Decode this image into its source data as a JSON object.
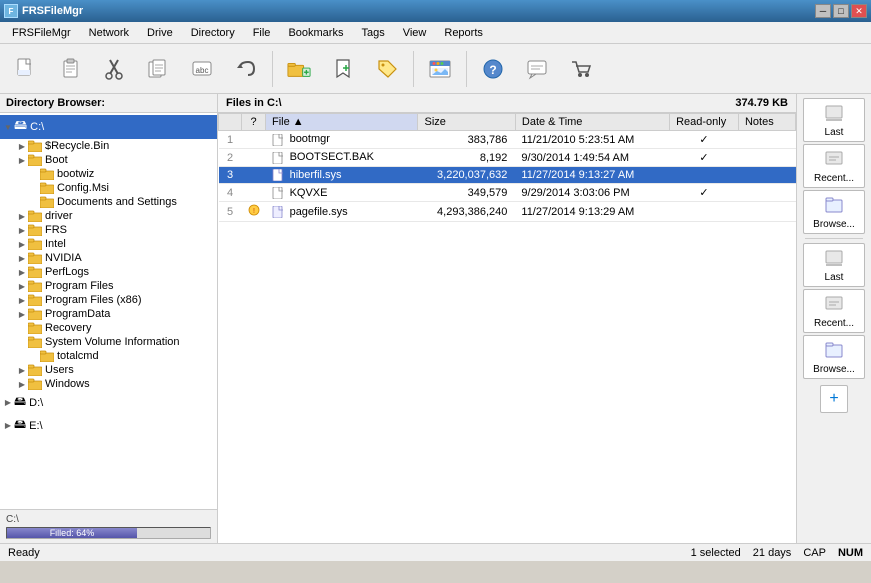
{
  "window": {
    "title": "FRSFileMgr",
    "icon": "F"
  },
  "title_controls": {
    "minimize": "─",
    "maximize": "□",
    "close": "✕"
  },
  "menu": {
    "items": [
      "FRSFileMgr",
      "Network",
      "Drive",
      "Directory",
      "File",
      "Bookmarks",
      "Tags",
      "View",
      "Reports"
    ]
  },
  "toolbar": {
    "buttons": [
      {
        "name": "new",
        "icon": "📄"
      },
      {
        "name": "open",
        "icon": "📋"
      },
      {
        "name": "cut",
        "icon": "✂"
      },
      {
        "name": "copy",
        "icon": "📄"
      },
      {
        "name": "rename",
        "icon": "abc"
      },
      {
        "name": "undo",
        "icon": "↩"
      },
      {
        "name": "browse",
        "icon": "📂"
      },
      {
        "name": "add-bookmark",
        "icon": "🔖"
      },
      {
        "name": "tag",
        "icon": "🏷"
      },
      {
        "name": "image",
        "icon": "🖼"
      },
      {
        "name": "help",
        "icon": "?"
      },
      {
        "name": "chat",
        "icon": "💬"
      },
      {
        "name": "cart",
        "icon": "🛒"
      }
    ]
  },
  "dir_panel": {
    "header": "Directory Browser:",
    "tree": [
      {
        "id": "c-drive",
        "label": "C:\\",
        "indent": 0,
        "expanded": true,
        "is_drive": true,
        "selected": true
      },
      {
        "id": "recycle",
        "label": "$Recycle.Bin",
        "indent": 1,
        "expanded": false
      },
      {
        "id": "boot",
        "label": "Boot",
        "indent": 1,
        "expanded": false
      },
      {
        "id": "bootwiz",
        "label": "bootwiz",
        "indent": 1,
        "expanded": false
      },
      {
        "id": "config",
        "label": "Config.Msi",
        "indent": 1,
        "expanded": false
      },
      {
        "id": "docs",
        "label": "Documents and Settings",
        "indent": 1,
        "expanded": false
      },
      {
        "id": "driver",
        "label": "driver",
        "indent": 1,
        "expanded": false
      },
      {
        "id": "frs",
        "label": "FRS",
        "indent": 1,
        "expanded": false
      },
      {
        "id": "intel",
        "label": "Intel",
        "indent": 1,
        "expanded": false
      },
      {
        "id": "nvidia",
        "label": "NVIDIA",
        "indent": 1,
        "expanded": false
      },
      {
        "id": "perflogs",
        "label": "PerfLogs",
        "indent": 1,
        "expanded": false
      },
      {
        "id": "programfiles",
        "label": "Program Files",
        "indent": 1,
        "expanded": false
      },
      {
        "id": "programfilesx86",
        "label": "Program Files (x86)",
        "indent": 1,
        "expanded": false
      },
      {
        "id": "programdata",
        "label": "ProgramData",
        "indent": 1,
        "expanded": false
      },
      {
        "id": "recovery",
        "label": "Recovery",
        "indent": 1,
        "expanded": false
      },
      {
        "id": "systemvolume",
        "label": "System Volume Information",
        "indent": 1,
        "expanded": false
      },
      {
        "id": "totalcmd",
        "label": "totalcmd",
        "indent": 1,
        "expanded": false
      },
      {
        "id": "users",
        "label": "Users",
        "indent": 1,
        "expanded": false
      },
      {
        "id": "windows",
        "label": "Windows",
        "indent": 1,
        "expanded": false
      },
      {
        "id": "d-drive",
        "label": "D:\\",
        "indent": 0,
        "expanded": false,
        "is_drive": true
      },
      {
        "id": "e-drive",
        "label": "E:\\",
        "indent": 0,
        "expanded": false,
        "is_drive": true
      }
    ],
    "drive_label": "C:\\",
    "progress_label": "Filled:  64%",
    "progress_pct": 64
  },
  "file_panel": {
    "header": "Files in C:\\",
    "size_info": "374.79 KB",
    "columns": [
      {
        "id": "num",
        "label": ""
      },
      {
        "id": "flag",
        "label": "?"
      },
      {
        "id": "file",
        "label": "File",
        "sorted": true
      },
      {
        "id": "size",
        "label": "Size"
      },
      {
        "id": "datetime",
        "label": "Date & Time"
      },
      {
        "id": "readonly",
        "label": "Read-only"
      },
      {
        "id": "notes",
        "label": "Notes"
      }
    ],
    "files": [
      {
        "num": 1,
        "flag": "",
        "name": "bootmgr",
        "icon": "file",
        "size": "383,786",
        "datetime": "11/21/2010 5:23:51 AM",
        "readonly": true,
        "notes": ""
      },
      {
        "num": 2,
        "flag": "",
        "name": "BOOTSECT.BAK",
        "icon": "file",
        "size": "8,192",
        "datetime": "9/30/2014 1:49:54 AM",
        "readonly": true,
        "notes": ""
      },
      {
        "num": 3,
        "flag": "",
        "name": "hiberfil.sys",
        "icon": "file",
        "size": "3,220,037,632",
        "datetime": "11/27/2014 9:13:27 AM",
        "readonly": false,
        "notes": "",
        "selected": true
      },
      {
        "num": 4,
        "flag": "",
        "name": "KQVXE",
        "icon": "file",
        "size": "349,579",
        "datetime": "9/29/2014 3:03:06 PM",
        "readonly": true,
        "notes": ""
      },
      {
        "num": 5,
        "flag": "",
        "name": "pagefile.sys",
        "icon": "sys",
        "size": "4,293,386,240",
        "datetime": "11/27/2014 9:13:29 AM",
        "readonly": false,
        "notes": ""
      }
    ]
  },
  "right_panel": {
    "buttons": [
      {
        "name": "last",
        "label": "Last"
      },
      {
        "name": "recent",
        "label": "Recent..."
      },
      {
        "name": "browse",
        "label": "Browse..."
      },
      {
        "name": "last2",
        "label": "Last"
      },
      {
        "name": "recent2",
        "label": "Recent..."
      },
      {
        "name": "browse2",
        "label": "Browse..."
      }
    ],
    "add_label": "+"
  },
  "status_bar": {
    "left": "Ready",
    "selected": "1 selected",
    "days": "21 days",
    "cap": "CAP",
    "num": "NUM"
  }
}
